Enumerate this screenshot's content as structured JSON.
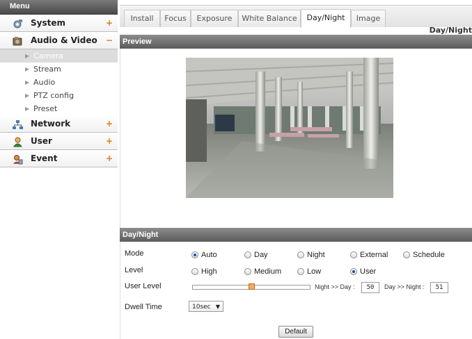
{
  "sidebar": {
    "header": "Menu",
    "categories": [
      {
        "label": "System",
        "toggle": "+"
      },
      {
        "label": "Audio & Video",
        "toggle": "−"
      },
      {
        "label": "Network",
        "toggle": "+"
      },
      {
        "label": "User",
        "toggle": "+"
      },
      {
        "label": "Event",
        "toggle": "+"
      }
    ],
    "subitems": [
      "Camera",
      "Stream",
      "Audio",
      "PTZ config",
      "Preset"
    ],
    "active_subitem": "Camera"
  },
  "tabs": [
    "Install",
    "Focus",
    "Exposure",
    "White Balance",
    "Day/Night",
    "Image"
  ],
  "active_tab": "Day/Night",
  "page_heading": "Day/Night",
  "preview": {
    "title": "Preview"
  },
  "daynight": {
    "title": "Day/Night",
    "mode": {
      "label": "Mode",
      "options": [
        "Auto",
        "Day",
        "Night",
        "External",
        "Schedule"
      ],
      "selected": "Auto"
    },
    "level": {
      "label": "Level",
      "options": [
        "High",
        "Medium",
        "Low",
        "User"
      ],
      "selected": "User"
    },
    "user_level": {
      "label": "User Level",
      "slider_value_fraction": 0.5,
      "night_to_day_label": "Night >> Day :",
      "night_to_day_value": "50",
      "day_to_night_label": "Day >> Night :",
      "day_to_night_value": "51"
    },
    "dwell_time": {
      "label": "Dwell Time",
      "selected": "10sec"
    },
    "default_button": "Default"
  },
  "colors": {
    "accent_toggle": "#e07a1a",
    "bar_dark": "#5c5c5c",
    "radio_selected": "#1a4fb0",
    "slider_thumb": "#f5a860"
  }
}
